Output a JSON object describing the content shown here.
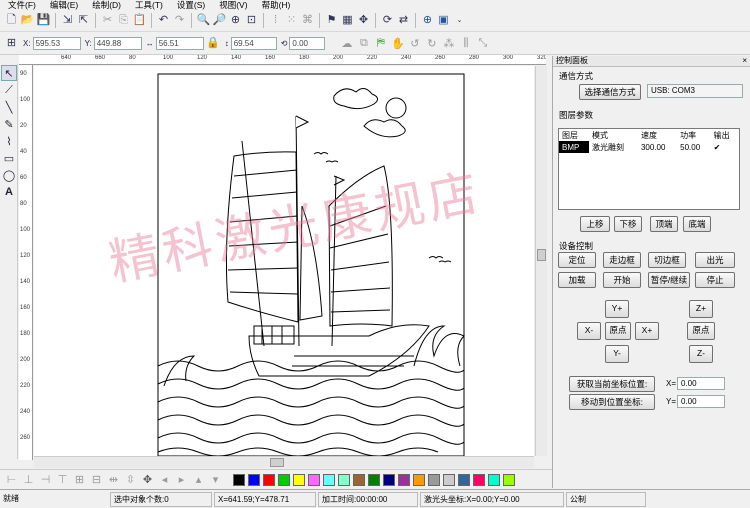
{
  "menu": [
    "文件(F)",
    "编辑(E)",
    "绘制(D)",
    "工具(T)",
    "设置(S)",
    "视图(V)",
    "帮助(H)"
  ],
  "toolbar2": {
    "x_label": "X:",
    "x_value": "595.53",
    "y_label": "Y:",
    "y_value": "449.88",
    "w_value": "56.51",
    "h_value": "69.54",
    "angle_value": "0.00"
  },
  "ruler": {
    "h_labels": [
      "640",
      "660",
      "80",
      "100",
      "120",
      "140",
      "160",
      "180",
      "200",
      "220",
      "240",
      "260",
      "280",
      "300",
      "320"
    ],
    "v_labels": [
      "90",
      "100",
      "20",
      "40",
      "60",
      "80",
      "100",
      "120",
      "140",
      "160",
      "180",
      "200",
      "220",
      "240",
      "260"
    ]
  },
  "panel": {
    "title": "控制面板",
    "close": "×",
    "comm_section": "通信方式",
    "select_comm_button": "选择通信方式",
    "comm_value": "USB: COM3",
    "layer_section": "图层参数",
    "layer_columns": [
      "图层",
      "模式",
      "速度",
      "功率",
      "输出"
    ],
    "layer_rows": [
      {
        "layer": "BMP",
        "mode": "激光雕刻",
        "speed": "300.00",
        "power": "50.00",
        "output": "✔"
      }
    ],
    "layer_buttons": [
      "上移",
      "下移",
      "顶端",
      "底端"
    ],
    "device_section": "设备控制",
    "device_buttons_row1": [
      "定位",
      "走边框",
      "切边框",
      "出光"
    ],
    "device_buttons_row2": [
      "加载",
      "开始",
      "暂停/继续",
      "停止"
    ],
    "jog": {
      "yplus": "Y+",
      "xminus": "X-",
      "origin": "原点",
      "xplus": "X+",
      "yminus": "Y-",
      "zplus": "Z+",
      "zorigin": "原点",
      "zminus": "Z-"
    },
    "get_pos_button": "获取当前坐标位置:",
    "move_pos_button": "移动到位置坐标:",
    "x_label": "X=",
    "x_value": "0.00",
    "y_label": "Y=",
    "y_value": "0.00"
  },
  "watermark": "精科激光康规店",
  "palette": [
    "#000000",
    "#0000ff",
    "#ff0000",
    "#00cc00",
    "#ffff00",
    "#ff66ff",
    "#66ffff",
    "#80ffcc",
    "#996633",
    "#008000",
    "#000080",
    "#993399",
    "#ff9900",
    "#999999",
    "#cccccc",
    "#336699",
    "#ff0066",
    "#00ffcc",
    "#99ff00"
  ],
  "status": {
    "ready": "就绪",
    "selected": "选中对象个数:0",
    "cursor": "X=641.59;Y=478.71",
    "process_time": "加工时间:00:00:00",
    "laser_head": "激光头坐标:X=0.00;Y=0.00",
    "unit": "公制"
  },
  "colors": {
    "panel_bg": "#f0f0f0",
    "watermark": "#e67896",
    "selected_row": "#000000"
  },
  "icons": [
    "new-icon",
    "open-icon",
    "save-icon",
    "import-icon",
    "export-icon",
    "cut-icon",
    "copy-icon",
    "paste-icon",
    "undo-icon",
    "redo-icon",
    "zoom-in-icon",
    "zoom-out-icon",
    "zoom-fit-icon"
  ]
}
